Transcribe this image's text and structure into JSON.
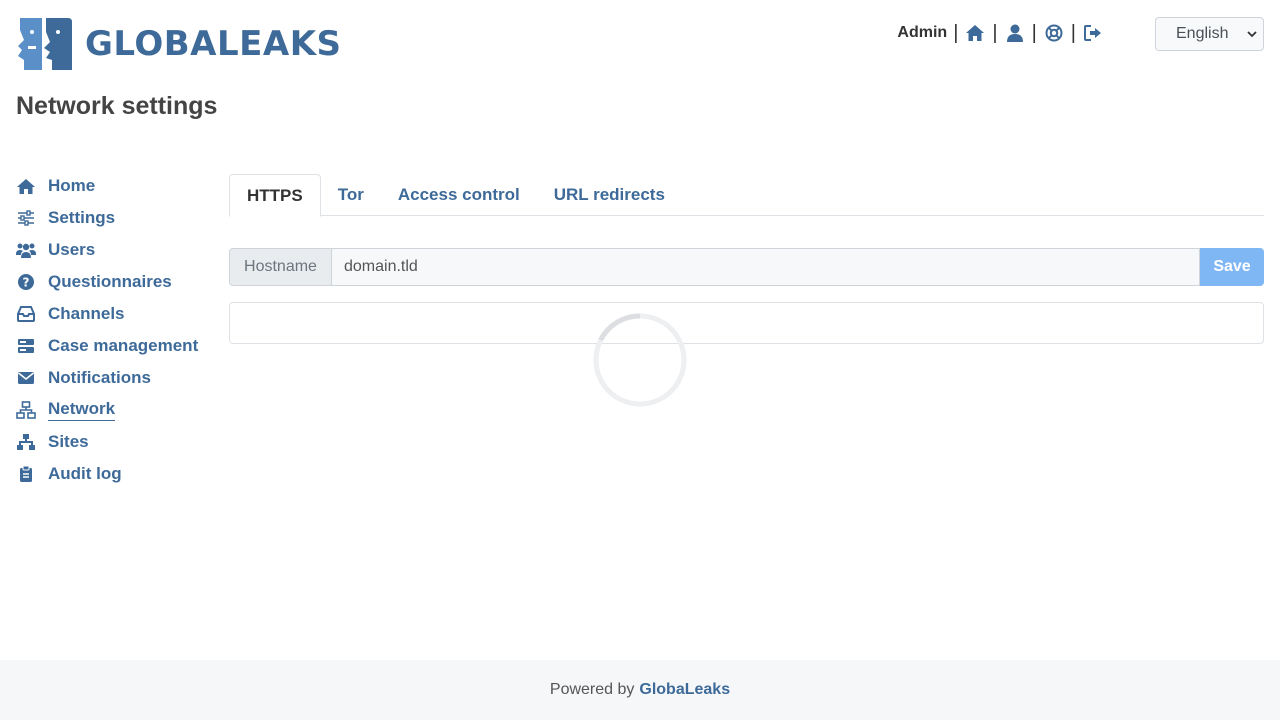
{
  "header": {
    "logo_text": "GLOBALEAKS",
    "user": "Admin",
    "separator": "|",
    "icons": [
      "home-icon",
      "user-icon",
      "lifebuoy-icon",
      "logout-icon"
    ],
    "language": "English"
  },
  "page_title": "Network settings",
  "sidebar": {
    "items": [
      {
        "label": "Home",
        "icon": "home-icon"
      },
      {
        "label": "Settings",
        "icon": "sliders-icon"
      },
      {
        "label": "Users",
        "icon": "users-icon"
      },
      {
        "label": "Questionnaires",
        "icon": "question-circle-icon"
      },
      {
        "label": "Channels",
        "icon": "inbox-icon"
      },
      {
        "label": "Case management",
        "icon": "server-icon"
      },
      {
        "label": "Notifications",
        "icon": "envelope-icon"
      },
      {
        "label": "Network",
        "icon": "network-icon",
        "active": true
      },
      {
        "label": "Sites",
        "icon": "sitemap-icon"
      },
      {
        "label": "Audit log",
        "icon": "clipboard-icon"
      }
    ]
  },
  "tabs": [
    {
      "label": "HTTPS",
      "active": true
    },
    {
      "label": "Tor"
    },
    {
      "label": "Access control"
    },
    {
      "label": "URL redirects"
    }
  ],
  "hostname": {
    "label": "Hostname",
    "value": "domain.tld",
    "save_label": "Save"
  },
  "footer": {
    "prefix": "Powered by",
    "brand": "GlobaLeaks"
  },
  "colors": {
    "accent": "#3e6a99",
    "save_button": "#7fb7f5",
    "footer_bg": "#f6f7f9"
  }
}
